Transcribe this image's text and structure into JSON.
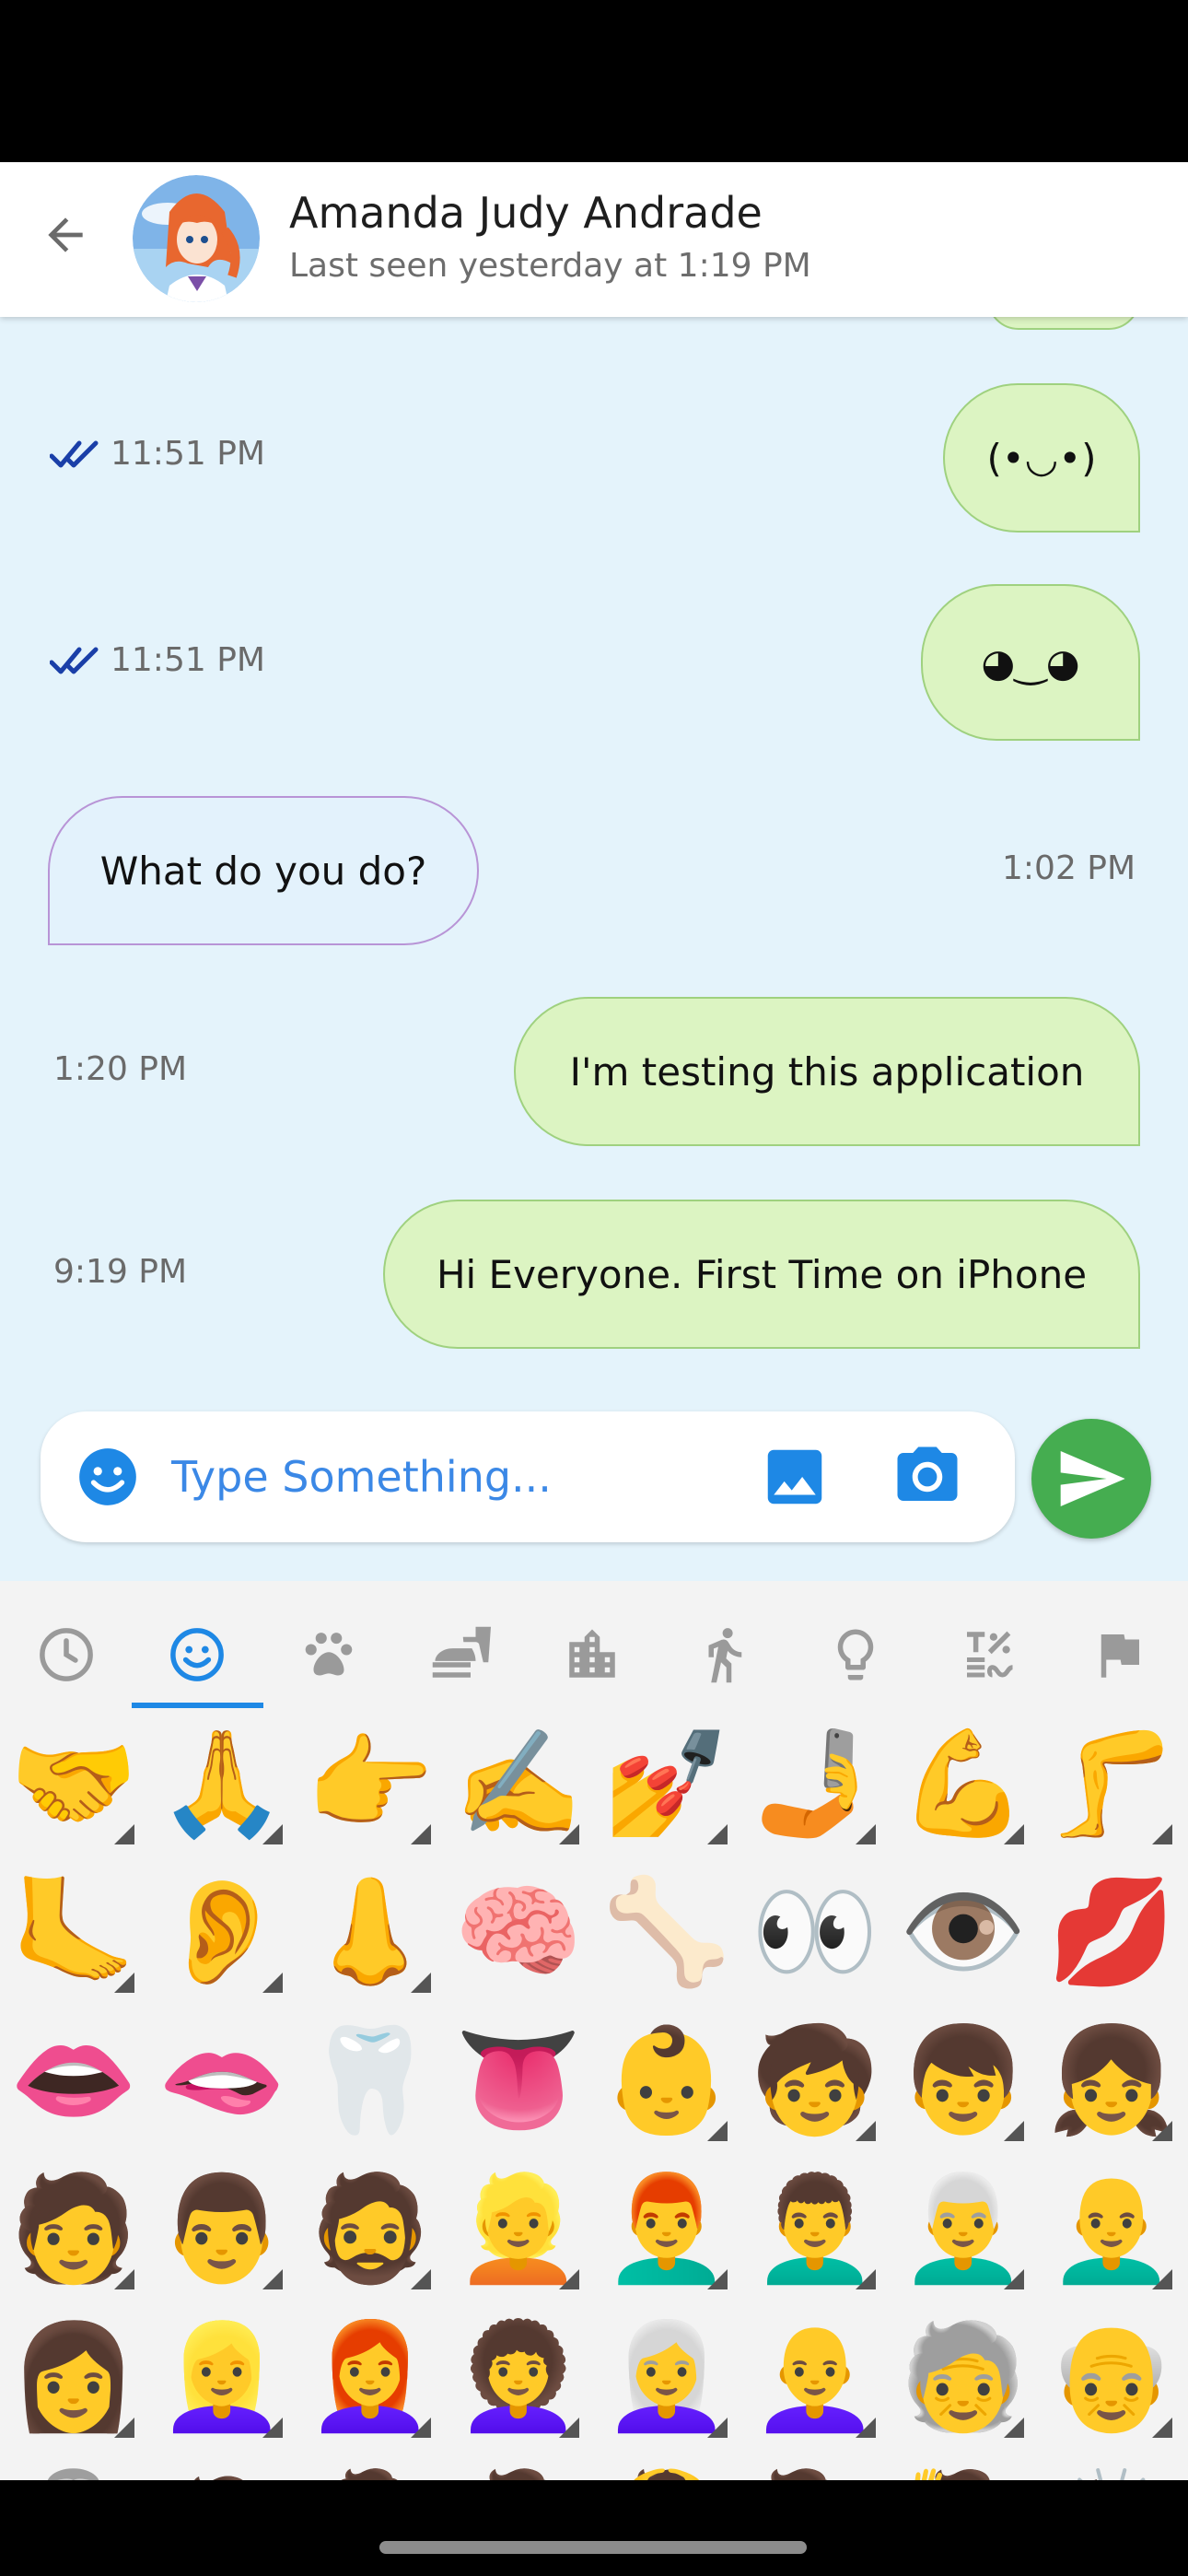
{
  "header": {
    "contact_name": "Amanda Judy Andrade",
    "last_seen": "Last seen yesterday at 1:19 PM"
  },
  "messages": [
    {
      "direction": "out",
      "text": "(•◡•)",
      "time": "11:51 PM",
      "read": true
    },
    {
      "direction": "out",
      "text": "◕‿◕",
      "time": "11:51 PM",
      "read": true
    },
    {
      "direction": "in",
      "text": "What do you do?",
      "time": "1:02 PM"
    },
    {
      "direction": "out",
      "text": "I'm testing this application",
      "time": "1:20 PM"
    },
    {
      "direction": "out",
      "text": "Hi Everyone. First Time on iPhone",
      "time": "9:19 PM"
    }
  ],
  "input": {
    "placeholder": "Type Something..."
  },
  "colors": {
    "chat_background": "#e4f3fb",
    "outgoing_bubble": "#dcf4c2",
    "incoming_bubble": "#e3f2fc",
    "accent": "#1e88e5",
    "send_button": "#45ad50",
    "read_ticks": "#1a3fa8"
  },
  "emoji_categories": [
    {
      "icon": "clock-icon",
      "selected": false
    },
    {
      "icon": "smiley-icon",
      "selected": true
    },
    {
      "icon": "paw-icon",
      "selected": false
    },
    {
      "icon": "food-icon",
      "selected": false
    },
    {
      "icon": "building-icon",
      "selected": false
    },
    {
      "icon": "running-person-icon",
      "selected": false
    },
    {
      "icon": "lightbulb-icon",
      "selected": false
    },
    {
      "icon": "symbols-icon",
      "selected": false
    },
    {
      "icon": "flag-icon",
      "selected": false
    }
  ],
  "emoji_rows": [
    [
      "🤝",
      "🙏",
      "👉",
      "✍️",
      "💅",
      "🤳",
      "💪",
      "🦵"
    ],
    [
      "🦶",
      "👂",
      "👃",
      "🧠",
      "🦴",
      "👀",
      "👁️",
      "💋"
    ],
    [
      "👄",
      "🫦",
      "🦷",
      "👅",
      "👶",
      "🧒",
      "👦",
      "👧"
    ],
    [
      "🧑",
      "👨",
      "🧔",
      "👱",
      "👨‍🦰",
      "👨‍🦱",
      "👨‍🦳",
      "👨‍🦲"
    ],
    [
      "👩",
      "👱‍♀️",
      "👩‍🦰",
      "👩‍🦱",
      "👩‍🦳",
      "👩‍🦲",
      "🧓",
      "👴"
    ],
    [
      "👵",
      "🙍",
      "🙎",
      "🙅",
      "🙆",
      "💁",
      "🙋",
      "🙇"
    ]
  ],
  "emoji_variant_markers": [
    [
      true,
      true,
      true,
      true,
      true,
      true,
      true,
      true
    ],
    [
      true,
      true,
      true,
      false,
      false,
      false,
      false,
      false
    ],
    [
      false,
      false,
      false,
      false,
      true,
      true,
      true,
      true
    ],
    [
      true,
      true,
      true,
      true,
      true,
      true,
      true,
      true
    ],
    [
      true,
      true,
      true,
      true,
      true,
      true,
      true,
      true
    ],
    [
      true,
      true,
      true,
      true,
      true,
      true,
      true,
      true
    ]
  ]
}
